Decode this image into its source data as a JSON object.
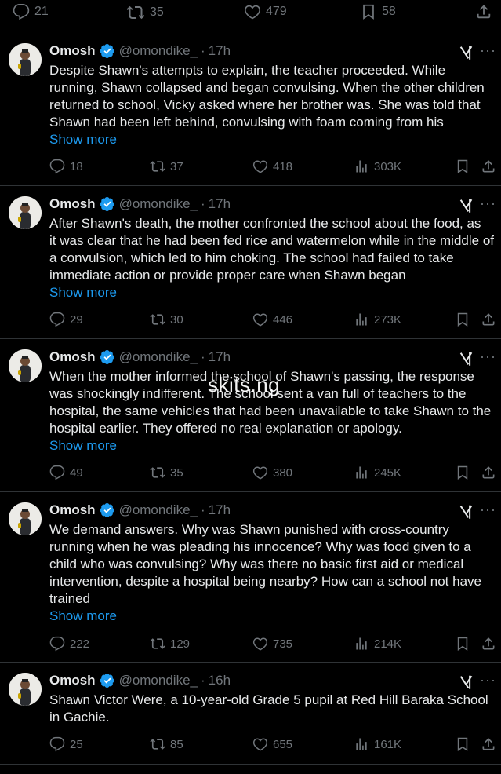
{
  "top_actions": {
    "replies": "21",
    "reposts": "35",
    "likes": "479",
    "bookmarks": "58"
  },
  "watermark": "skits.ng",
  "tweets": [
    {
      "name": "Omosh",
      "handle": "@omondike_",
      "dot": "·",
      "time": "17h",
      "text": "Despite Shawn's attempts to explain, the teacher proceeded. While\nrunning, Shawn collapsed and began convulsing. When the other children\nreturned to school, Vicky asked where her brother was. She was told that\nShawn had been left behind, convulsing with foam coming from his",
      "show_more": "Show more",
      "replies": "18",
      "reposts": "37",
      "likes": "418",
      "views": "303K"
    },
    {
      "name": "Omosh",
      "handle": "@omondike_",
      "dot": "·",
      "time": "17h",
      "text": "After Shawn's death, the mother confronted the school about the food, as\nit was clear that he had been fed rice and watermelon while in the middle of\na convulsion, which led to him choking. The school had failed to take\nimmediate action or provide proper care when Shawn began",
      "show_more": "Show more",
      "replies": "29",
      "reposts": "30",
      "likes": "446",
      "views": "273K"
    },
    {
      "name": "Omosh",
      "handle": "@omondike_",
      "dot": "·",
      "time": "17h",
      "text": "When the mother informed the school of Shawn's passing, the response\nwas shockingly indifferent. The school sent a van full of teachers to the\nhospital, the same vehicles that had been unavailable to take Shawn to the\nhospital earlier. They offered no real explanation or apology.",
      "show_more": "Show more",
      "replies": "49",
      "reposts": "35",
      "likes": "380",
      "views": "245K"
    },
    {
      "name": "Omosh",
      "handle": "@omondike_",
      "dot": "·",
      "time": "17h",
      "text": "We demand answers. Why was Shawn punished with cross-country\nrunning when he was pleading his innocence? Why was food given to a\nchild who was convulsing? Why was there no basic first aid or medical\nintervention, despite a hospital being nearby? How can a school not have\ntrained",
      "show_more": "Show more",
      "replies": "222",
      "reposts": "129",
      "likes": "735",
      "views": "214K"
    },
    {
      "name": "Omosh",
      "handle": "@omondike_",
      "dot": "·",
      "time": "16h",
      "text": "Shawn Victor Were, a 10-year-old Grade 5 pupil at Red Hill Baraka School\nin Gachie.",
      "replies": "25",
      "reposts": "85",
      "likes": "655",
      "views": "161K"
    }
  ]
}
